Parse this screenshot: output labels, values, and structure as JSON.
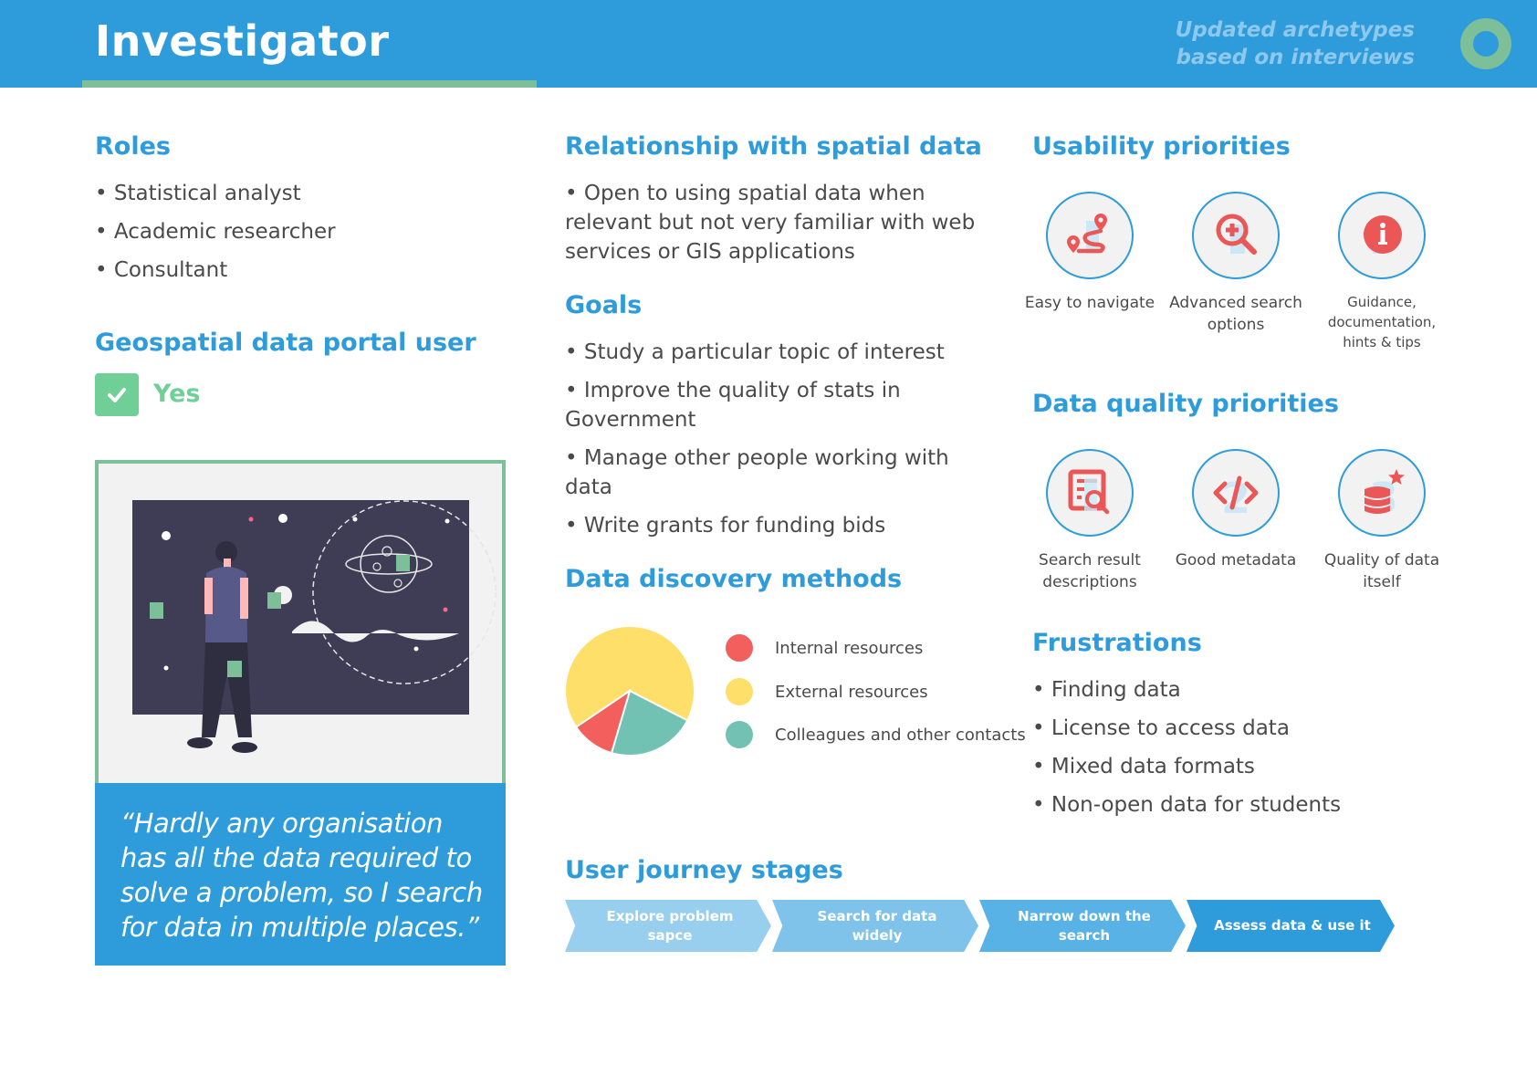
{
  "header": {
    "title": "Investigator",
    "subtitle_line1": "Updated archetypes",
    "subtitle_line2": "based on interviews",
    "logo_icon": "ring-logo-icon",
    "colors": {
      "bar": "#2e9bdb",
      "accent_green": "#7dbf98"
    }
  },
  "roles": {
    "heading": "Roles",
    "items": [
      "• Statistical analyst",
      "• Academic researcher",
      "• Consultant"
    ]
  },
  "portal_user": {
    "heading": "Geospatial data portal user",
    "value": "Yes",
    "icon": "checkmark-icon",
    "color": "#6fcf97"
  },
  "illustration": {
    "icon": "person-viewing-space-board-illustration"
  },
  "quote": {
    "text": "“Hardly any organisation has all the data required to solve a problem, so I search for data in multiple places.”"
  },
  "relationship": {
    "heading": "Relationship with spatial data",
    "text": "• Open to using spatial data when relevant but not very familiar with web services or GIS applications"
  },
  "goals": {
    "heading": "Goals",
    "items": [
      "• Study a particular topic of interest",
      "• Improve the quality of stats in Government",
      "• Manage other people working with data",
      "• Write grants for funding bids"
    ]
  },
  "discovery": {
    "heading": "Data discovery methods"
  },
  "chart_data": {
    "type": "pie",
    "title": "Data discovery methods",
    "legend_position": "right",
    "slices": [
      {
        "label": "External resources",
        "value": 67,
        "color": "#fedf6a"
      },
      {
        "label": "Colleagues and other contacts",
        "value": 22,
        "color": "#71c2b3"
      },
      {
        "label": "Internal resources",
        "value": 11,
        "color": "#f25f5c"
      }
    ],
    "legend": [
      {
        "label": "Internal resources",
        "color": "#f25f5c"
      },
      {
        "label": "External resources",
        "color": "#fedf6a"
      },
      {
        "label": "Colleagues and other contacts",
        "color": "#71c2b3"
      }
    ]
  },
  "usability": {
    "heading": "Usability priorities",
    "items": [
      {
        "label": "Easy to navigate",
        "icon": "route-map-pin-icon"
      },
      {
        "label": "Advanced search options",
        "icon": "zoom-plus-magnifier-icon"
      },
      {
        "label": "Guidance, documentation, hints & tips",
        "icon": "info-icon"
      }
    ]
  },
  "data_quality": {
    "heading": "Data quality priorities",
    "items": [
      {
        "label": "Search result descriptions",
        "icon": "document-search-icon"
      },
      {
        "label": "Good metadata",
        "icon": "code-brackets-icon"
      },
      {
        "label": "Quality of data itself",
        "icon": "database-star-icon"
      }
    ]
  },
  "frustrations": {
    "heading": "Frustrations",
    "items": [
      "• Finding data",
      "• License to access data",
      "• Mixed data formats",
      "• Non-open data for students"
    ]
  },
  "journey": {
    "heading": "User journey stages",
    "stages": [
      {
        "label": "Explore problem sapce",
        "color": "#99cfee"
      },
      {
        "label": "Search for data widely",
        "color": "#80c3ea"
      },
      {
        "label": "Narrow down the search",
        "color": "#59b2e5"
      },
      {
        "label": "Assess data & use it",
        "color": "#2e9bdb"
      }
    ]
  }
}
